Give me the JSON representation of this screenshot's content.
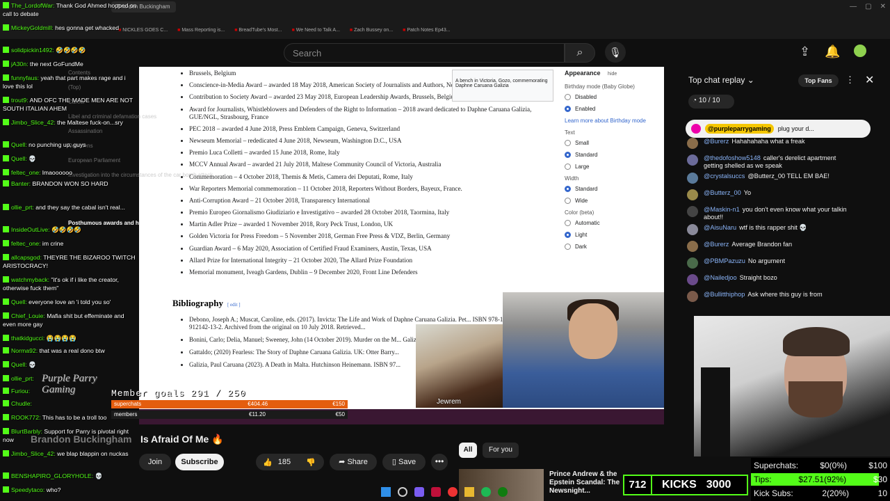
{
  "browser": {
    "tabs": [
      "Brandon Buckingham"
    ],
    "bookmarks": [
      "NICKLES GOES C...",
      "Mass Reporting is...",
      "BreadTube's Most...",
      "We Need to Talk A...",
      "Zach Bussey on...",
      "Patch Notes Ep43..."
    ]
  },
  "youtube": {
    "search_placeholder": "Search",
    "video_title": "Is Afraid Of Me 🔥",
    "channel_name": "Brandon Buckingham",
    "join_label": "Join",
    "subscribe_label": "Subscribe",
    "like_count": "185",
    "share_label": "Share",
    "save_label": "Save",
    "chips": [
      "All",
      "For you"
    ],
    "rec_title": "Prince Andrew & the Epstein Scandal: The Newsnight..."
  },
  "wiki": {
    "awards": [
      "Brussels, Belgium",
      "Conscience-in-Media Award – awarded 18 May 2018, American Society of Journalists and Authors, New York City",
      "Contribution to Society Award – awarded 23 May 2018, European Leadership Awards, Brussels, Belgium",
      "Award for Journalists, Whistleblowers and Defenders of the Right to Information – 2018 award dedicated to Daphne Caruana Galizia, GUE/NGL, Strasbourg, France",
      "PEC 2018 – awarded 4 June 2018, Press Emblem Campaign, Geneva, Switzerland",
      "Newseum Memorial – rededicated 4 June 2018, Newseum, Washington D.C., USA",
      "Premio Luca Colletti – awarded 15 June 2018, Rome, Italy",
      "MCCV Annual Award – awarded 21 July 2018, Maltese Community Council of Victoria, Australia",
      "Commemoration – 4 October 2018, Themis & Metis, Camera dei Deputati, Rome, Italy",
      "War Reporters Memorial commemoration – 11 October 2018, Reporters Without Borders, Bayeux, France.",
      "Anti-Corruption Award – 21 October 2018, Transparency International",
      "Premio Europeo Giornalismo Giudiziario e Investigativo – awarded 28 October 2018, Taormina, Italy",
      "Martin Adler Prize – awarded 1 November 2018, Rory Peck Trust, London, UK",
      "Golden Victoria for Press Freedom – 5 November 2018, German Free Press & VDZ, Berlin, Germany",
      "Guardian Award – 6 May 2020, Association of Certified Fraud Examiners, Austin, Texas, USA",
      "Allard Prize for International Integrity – 21 October 2020, The Allard Prize Foundation",
      "Memorial monument, Iveagh Gardens, Dublin – 9 December 2020, Front Line Defenders"
    ],
    "bibliography_heading": "Bibliography",
    "edit_label": "[ edit ]",
    "bibliography": [
      "Debono, Joseph A.; Muscat, Caroline, eds. (2017). Invicta: The Life and Work of Daphne Caruana Galizia. Pet... ISBN 978-1-912142-13-2. Archived from the original on 10 July 2018. Retrieved...",
      "Bonini, Carlo; Delia, Manuel; Sweeney, John (14 October 2019). Murder on the M... Galizia?. Malta: Midsea Press.",
      "Gattaldo; (2020) Fearless: The Story of Daphne Caruana Galizia. UK: Otter Barry...",
      "Galizia, Paul Caruana (2023). A Death in Malta. Hutchinson Heinemann. ISBN 97..."
    ],
    "image_caption": "A bench in Victoria, Gozo, commemorating Daphne Caruana Galizia",
    "appearance": {
      "title": "Appearance",
      "hide": "hide",
      "birthday_label": "Birthday mode (Baby Globe)",
      "birthday_options": [
        "Disabled",
        "Enabled"
      ],
      "birthday_link": "Learn more about Birthday mode",
      "text_label": "Text",
      "text_options": [
        "Small",
        "Standard",
        "Large"
      ],
      "width_label": "Width",
      "width_options": [
        "Standard",
        "Wide"
      ],
      "color_label": "Color (beta)",
      "color_options": [
        "Automatic",
        "Light",
        "Dark"
      ]
    },
    "toc": [
      "Contents",
      "(Top)",
      "Career",
      "Libel and criminal defamation cases",
      "Assassination",
      "Reactions",
      "European Parliament",
      "Investigation into the circumstances of the car bomb attack"
    ],
    "toc_posthumous": "Posthumous awards and honours"
  },
  "overlay": {
    "goal_text": "Member goals  291 / 250",
    "superchats_label": "superchats",
    "superchats_value": "€404.46",
    "superchats_goal": "€150",
    "members_label": "members",
    "members_value": "€11.20",
    "members_goal": "€50",
    "cam1_label": "Jewrem",
    "kicks_count": "712",
    "kicks_label": "KICKS",
    "kicks_goal": "3000",
    "tips": [
      {
        "label": "Superchats:",
        "value": "$0(0%)",
        "goal": "$100"
      },
      {
        "label": "Tips:",
        "value": "$27.51(92%)",
        "goal": "$30"
      },
      {
        "label": "Kick Subs:",
        "value": "2(20%)",
        "goal": "10"
      }
    ],
    "pp_logo": "Purple Parry Gaming"
  },
  "yt_chat": {
    "header": "Top chat replay",
    "top_fans": "Top Fans",
    "counter": "10 / 10",
    "pinned_user": "@purpleparrygaming",
    "pinned_text": "plug your d...",
    "messages": [
      {
        "user": "@Burerz",
        "text": "Hahahahaha what a freak",
        "color": "#8a6d4a"
      },
      {
        "user": "@thedofoshow5148",
        "text": "caller's derelict apartment getting shelled as we speak",
        "color": "#6b6b9a"
      },
      {
        "user": "@crystalsuccs",
        "text": "@Butterz_00 TELL EM BAE!",
        "color": "#5a7a9a"
      },
      {
        "user": "@Butterz_00",
        "text": "Yo",
        "color": "#9a8a4a"
      },
      {
        "user": "@Maskin-n1",
        "text": "you don't even know what your talkin about!!",
        "color": "#444444"
      },
      {
        "user": "@AisuNaru",
        "text": "wtf is this rapper shit 💀",
        "color": "#8a8a9a"
      },
      {
        "user": "@Burerz",
        "text": "Average Brandon fan",
        "color": "#8a6d4a"
      },
      {
        "user": "@PBMPazuzu",
        "text": "No argument",
        "color": "#4a6a4a"
      },
      {
        "user": "@Nailedjoo",
        "text": "Straight bozo",
        "color": "#6a4a8a"
      },
      {
        "user": "@Bullitthiphop",
        "text": "Ask where this guy is from",
        "color": "#7a5a4a"
      }
    ]
  },
  "twitch_chat": [
    {
      "user": "The_LordofWar",
      "text": "Thank God Ahmed hopped on call to debate"
    },
    {
      "user": "MickeyGoldmill",
      "text": "hes gonna get whacked"
    },
    {
      "user": "solidpickin1492",
      "text": "🤣🤣🤣🤣"
    },
    {
      "user": "jA30n",
      "text": "the next GoFundMe"
    },
    {
      "user": "funnyfaus",
      "text": "yeah that part makes rage and i love this lol"
    },
    {
      "user": "trout9",
      "text": "AND OFC THE MADE MEN ARE NOT SOUTH ITALIAN AHEM"
    },
    {
      "user": "Jimbo_Slice_42",
      "text": "the Maltese fuck-on...sry"
    },
    {
      "user": "Quell",
      "text": "no punching up, guys"
    },
    {
      "user": "Quell",
      "text": "💀"
    },
    {
      "user": "feltec_one",
      "text": "lmaoooooo"
    },
    {
      "user": "Banter",
      "text": "BRANDON WON SO HARD"
    },
    {
      "user": "ollie_prt",
      "text": "and they say the cabal isn't real..."
    },
    {
      "user": "InsideOutLive",
      "text": "🤣🤣🤣🤣"
    },
    {
      "user": "feltec_one",
      "text": "im crine"
    },
    {
      "user": "allcapsgod",
      "text": "THEYRE THE BIZAROO TWITCH ARISTOCRACY!"
    },
    {
      "user": "watchmyback",
      "text": "\"it's ok if i like the creator, otherwise fuck them\""
    },
    {
      "user": "Quell",
      "text": "everyone love an 'i told you so'"
    },
    {
      "user": "Chief_Louie",
      "text": "Mafia shit but effeminate and even more gay"
    },
    {
      "user": "thatkidgucci",
      "text": "😭😭😭😭"
    },
    {
      "user": "Norma92",
      "text": "that was a real dono btw"
    },
    {
      "user": "Quell",
      "text": "💀"
    },
    {
      "user": "ollie_prt",
      "text": ""
    },
    {
      "user": "Furiou",
      "text": ""
    },
    {
      "user": "Chudle",
      "text": ""
    },
    {
      "user": "ROOK772",
      "text": "This has to be a troll too"
    },
    {
      "user": "BlurtBarbly",
      "text": "Support for Parry is pivotal right now"
    },
    {
      "user": "Jimbo_Slice_42",
      "text": "we blap blappin on nuckas"
    },
    {
      "user": "BENSHAPIRO_GLORYHOLE",
      "text": "💀"
    },
    {
      "user": "Speedytaco",
      "text": "who?"
    }
  ],
  "colors": {
    "kick_green": "#53fc18",
    "yt_bg": "#0f0f0f",
    "wiki_link": "#3366cc",
    "goal_orange": "#e45d0e"
  }
}
